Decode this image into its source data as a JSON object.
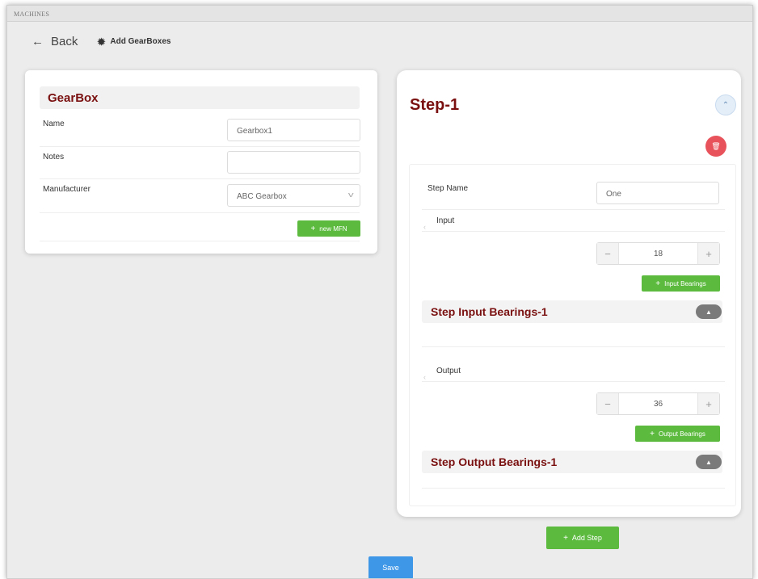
{
  "window": {
    "title": "MACHINES"
  },
  "nav": {
    "back_arrow": "←",
    "back_label": "Back",
    "crumb_icon": "✹",
    "crumb_label": "Add GearBoxes"
  },
  "gearbox": {
    "title": "GearBox",
    "name_label": "Name",
    "name_value": "Gearbox1",
    "notes_label": "Notes",
    "notes_value": "",
    "manufacturer_label": "Manufacturer",
    "manufacturer_value": "ABC Gearbox",
    "new_mfn_label": "new MFN"
  },
  "step": {
    "title": "Step-1",
    "collapse_icon": "⌃",
    "delete_icon": "🗑",
    "step_name_label": "Step Name",
    "step_name_value": "One",
    "input_label": "Input",
    "input_value": "18",
    "input_bearings_label": "Input Bearings",
    "input_bearings_title": "Step Input Bearings-1",
    "output_label": "Output",
    "output_value": "36",
    "output_bearings_label": "Output Bearings",
    "output_bearings_title": "Step Output Bearings-1"
  },
  "icons": {
    "plus": "+",
    "minus": "−",
    "chevron_left": "‹",
    "chevron_up": "▲",
    "caret_down": "v"
  },
  "actions": {
    "add_step_label": "Add Step",
    "save_label": "Save"
  },
  "colors": {
    "title_red": "#7a1010",
    "green": "#5cbb3f",
    "blue": "#3f97e8",
    "delete_red": "#e8525a"
  }
}
